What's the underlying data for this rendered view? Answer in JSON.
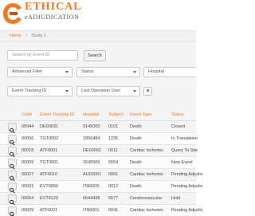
{
  "header": {
    "brand_title": "ETHICAL",
    "brand_sub": "eADJUDICATION"
  },
  "breadcrumb": {
    "home": "Home",
    "separator": "/",
    "current": "Study 1"
  },
  "filters": {
    "search_placeholder": "Search by Event ID",
    "search_button": "Search",
    "advanced_filter": "Advanced Filter",
    "status": "Status",
    "hospital": "Hospital",
    "event_tracking_id": "Event Tracking ID",
    "last_operation_user": "Last Operation User",
    "clear": "×"
  },
  "table": {
    "columns": [
      "Code",
      "Event Tracking ID",
      "Hospital",
      "Subject",
      "Event Type",
      "Status"
    ],
    "rows": [
      [
        "00044",
        "DE00031",
        "0145000",
        "0101",
        "Death",
        "Closed"
      ],
      [
        "00056",
        "TGT0002",
        "1856484",
        "1235",
        "Death",
        "In Translation"
      ],
      [
        "00018",
        "ATF0001",
        "DE00002",
        "0011",
        "Cardiac Ischemic",
        "Query To Site"
      ],
      [
        "00055",
        "TGT0001",
        "1645565",
        "6554",
        "Death",
        "New Event"
      ],
      [
        "00027",
        "ATF0010",
        "AU00001",
        "0061",
        "Cardiac Ischemic",
        "Pending Adjudication"
      ],
      [
        "00031",
        "EVT0059",
        "ITA0005",
        "0012",
        "Death",
        "Pending Adjudication"
      ],
      [
        "00054",
        "EVT4123",
        "6544438",
        "5677",
        "Cerebrovascular",
        "Hold"
      ],
      [
        "00029",
        "ATF0021",
        "ITA0001",
        "0041",
        "Cardiac Ischemic",
        "Pending Adjudication"
      ]
    ]
  },
  "colors": {
    "brand_orange": "#f07a22",
    "logo_dark": "#c8511a"
  },
  "icons": {
    "logo": "ethical-logo-icon",
    "view": "magnifier-icon",
    "dropdown": "caret-down-icon"
  }
}
